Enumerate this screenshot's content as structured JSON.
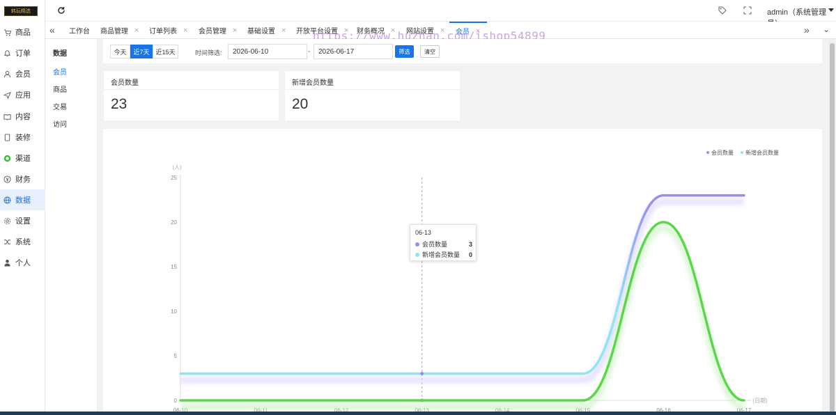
{
  "logo": {
    "text": "韩玩精选"
  },
  "sidebar": {
    "items": [
      {
        "label": "商品",
        "icon": "cart-icon"
      },
      {
        "label": "订单",
        "icon": "bell-icon"
      },
      {
        "label": "会员",
        "icon": "user-icon"
      },
      {
        "label": "应用",
        "icon": "send-icon"
      },
      {
        "label": "内容",
        "icon": "book-icon"
      },
      {
        "label": "装修",
        "icon": "tablet-icon"
      },
      {
        "label": "渠道",
        "icon": "wechat-icon"
      },
      {
        "label": "财务",
        "icon": "yen-icon"
      },
      {
        "label": "数据",
        "icon": "globe-icon"
      },
      {
        "label": "设置",
        "icon": "gear-icon"
      },
      {
        "label": "系统",
        "icon": "shuffle-icon"
      },
      {
        "label": "个人",
        "icon": "person-icon"
      }
    ],
    "active_index": 8
  },
  "header": {
    "user": "admin（系统管理员）"
  },
  "tabs": [
    {
      "label": "工作台",
      "closable": false
    },
    {
      "label": "商品管理",
      "closable": true
    },
    {
      "label": "订单列表",
      "closable": true
    },
    {
      "label": "会员管理",
      "closable": true
    },
    {
      "label": "基础设置",
      "closable": true
    },
    {
      "label": "开放平台设置",
      "closable": true
    },
    {
      "label": "财务概况",
      "closable": true
    },
    {
      "label": "网站设置",
      "closable": true
    },
    {
      "label": "会员",
      "closable": true
    }
  ],
  "watermark": "https://www.huzhan.com/ishop54899",
  "submenu": {
    "title": "数据",
    "items": [
      "会员",
      "商品",
      "交易",
      "访问"
    ],
    "active_index": 0
  },
  "filter": {
    "ranges": [
      "今天",
      "近7天",
      "近15天"
    ],
    "active_range": 1,
    "label": "时间筛选:",
    "start_date": "2026-06-10",
    "end_date": "2026-06-17",
    "separator": "-",
    "filter_button": "筛选",
    "clear_button": "清空"
  },
  "stats": [
    {
      "label": "会员数量",
      "value": "23"
    },
    {
      "label": "新增会员数量",
      "value": "20"
    }
  ],
  "tooltip": {
    "date": "06-13",
    "rows": [
      {
        "name": "会员数量",
        "value": "3"
      },
      {
        "name": "新增会员数量",
        "value": "0"
      }
    ]
  },
  "colors": {
    "accent": "#1a73e8",
    "series_members": "#9b8cf0",
    "series_members_light": "#8ee6f5",
    "series_new": "#5ad84a"
  },
  "chart_data": {
    "type": "line",
    "x": [
      "06-10",
      "06-11",
      "06-12",
      "06-13",
      "06-14",
      "06-15",
      "06-16",
      "06-17"
    ],
    "series": [
      {
        "name": "会员数量",
        "values": [
          3,
          3,
          3,
          3,
          3,
          3,
          23,
          23
        ]
      },
      {
        "name": "新增会员数量",
        "values": [
          0,
          0,
          0,
          0,
          0,
          0,
          20,
          0
        ]
      }
    ],
    "ylabel": "(人)",
    "xlabel": "(日期)",
    "ylim": [
      0,
      25
    ],
    "yticks": [
      0,
      5,
      10,
      15,
      20,
      25
    ],
    "legend": "top-right",
    "grid": false
  }
}
